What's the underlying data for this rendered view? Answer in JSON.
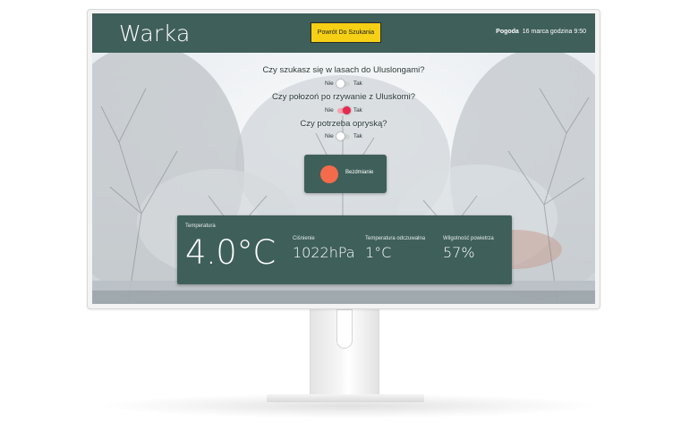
{
  "header": {
    "city": "Warka",
    "back_button": "Powrót Do Szukania",
    "weather_label": "Pogoda",
    "datetime": "16 marca godzina 9:50"
  },
  "questions": [
    {
      "text": "Czy szukasz się w lasach do Uluslongami?",
      "no": "Nie",
      "yes": "Tak",
      "state": "off"
    },
    {
      "text": "Czy połozoń po rzywanie z Uluskomi?",
      "no": "Nie",
      "yes": "Tak",
      "state": "on"
    },
    {
      "text": "Czy potrzeba opryską?",
      "no": "Nie",
      "yes": "Tak",
      "state": "off"
    }
  ],
  "recommendation": {
    "label": "Bezdmianie",
    "color": "#f36b4b"
  },
  "weather": {
    "temperature_label": "Temperatura",
    "temperature_value": "4.0°C",
    "pressure_label": "Ciśnienie",
    "pressure_value": "1022hPa",
    "feels_like_label": "Temperatura odczuwalna",
    "feels_like_value": "1°C",
    "humidity_label": "Wilgotność powietrza",
    "humidity_value": "57%"
  },
  "colors": {
    "header_bg": "#3f5f5a",
    "button_bg": "#f5d015",
    "toggle_on": "#e8284f"
  }
}
